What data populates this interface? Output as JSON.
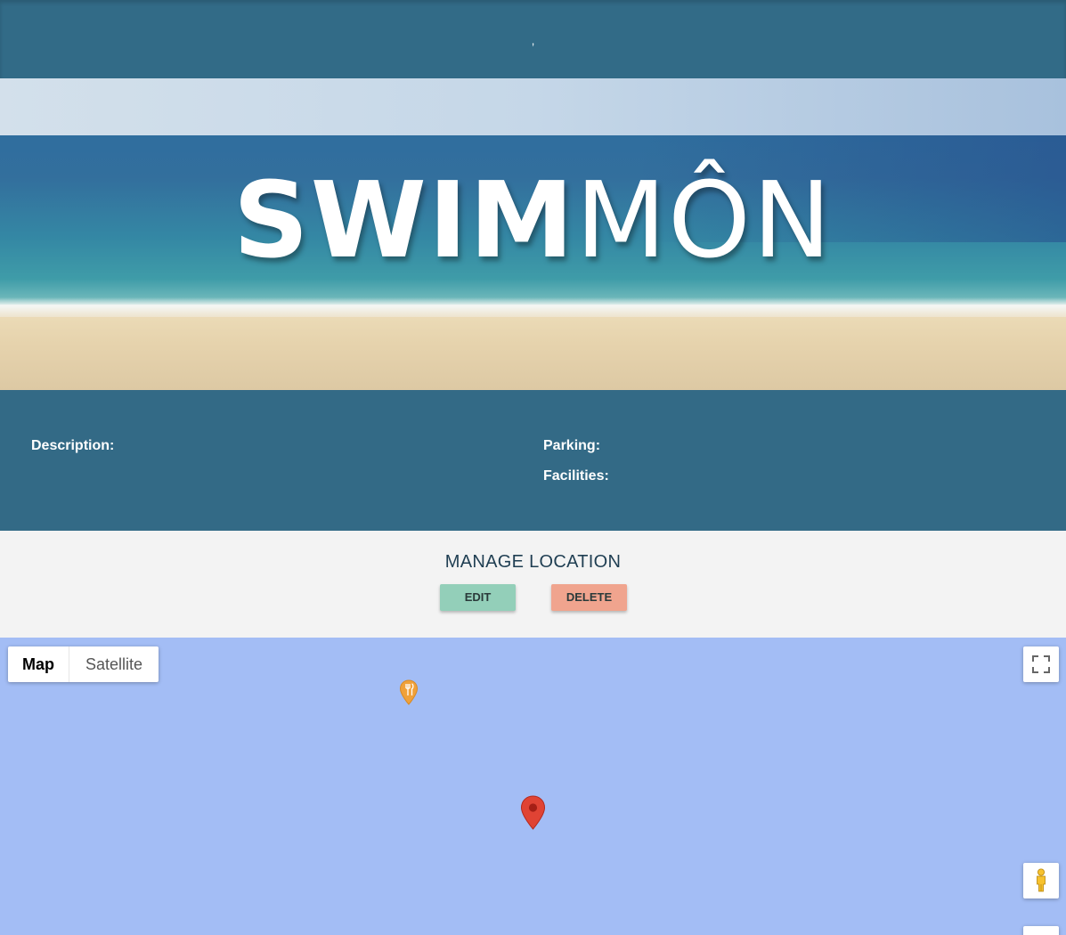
{
  "header": {
    "title": ","
  },
  "hero": {
    "logo_bold": "SWIM",
    "logo_light": "MÔN"
  },
  "info": {
    "description_label": "Description:",
    "parking_label": "Parking:",
    "facilities_label": "Facilities:"
  },
  "manage": {
    "heading": "MANAGE LOCATION",
    "edit_label": "EDIT",
    "delete_label": "DELETE",
    "edit_color": "#93cfb9",
    "delete_color": "#f0a48e"
  },
  "map": {
    "background_color": "#a3bdf5",
    "type_options": [
      "Map",
      "Satellite"
    ],
    "selected_type": "Map",
    "controls": [
      "fullscreen-icon",
      "pegman-icon"
    ],
    "markers": [
      {
        "kind": "restaurant-poi-icon",
        "color": "#f0a13a"
      },
      {
        "kind": "location-marker-icon",
        "color": "#e04334"
      }
    ]
  }
}
